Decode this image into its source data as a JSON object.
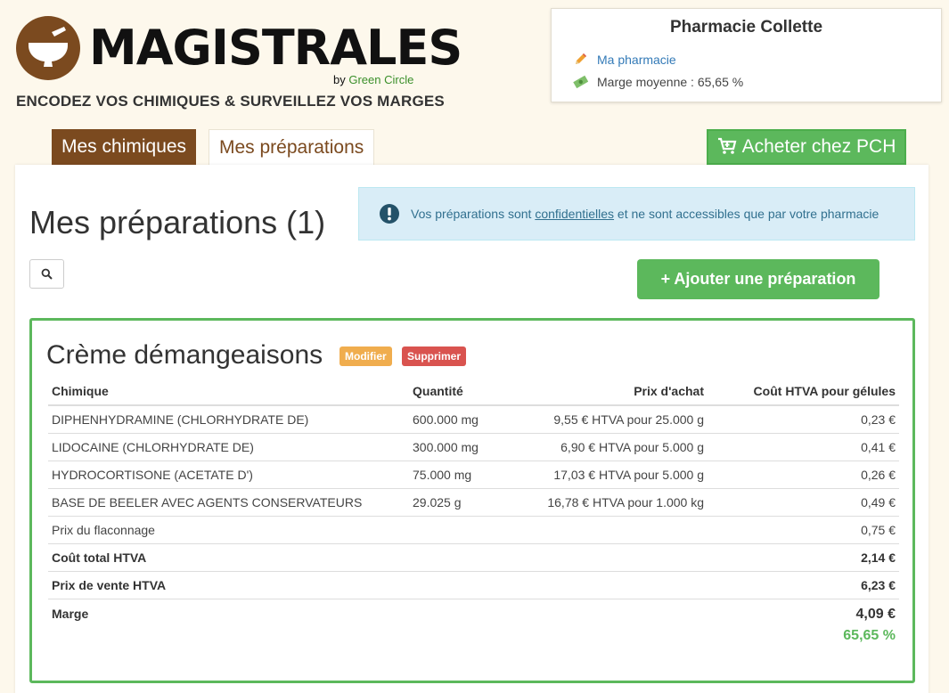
{
  "brand": {
    "name": "MAGISTRALES",
    "by": "by",
    "by_company": "Green Circle",
    "tagline": "ENCODEZ VOS CHIMIQUES & SURVEILLEZ VOS MARGES",
    "color": "#7b4a1f"
  },
  "pharmacy": {
    "name": "Pharmacie Collette",
    "link_label": "Ma pharmacie",
    "avg_margin": "Marge moyenne : 65,65 %"
  },
  "tabs": [
    {
      "label": "Mes chimiques",
      "active": true
    },
    {
      "label": "Mes préparations",
      "active": false
    }
  ],
  "buy_button": "Acheter chez PCH",
  "main": {
    "title": "Mes préparations (1)",
    "info": {
      "before": "Vos préparations sont ",
      "link": "confidentielles",
      "after": " et ne sont accessibles que par votre pharmacie"
    },
    "add_button": "+ Ajouter une préparation"
  },
  "preparation": {
    "title": "Crème démangeaisons",
    "edit_label": "Modifier",
    "delete_label": "Supprimer",
    "columns": [
      "Chimique",
      "Quantité",
      "Prix d'achat",
      "Coût HTVA pour gélules"
    ],
    "rows": [
      {
        "chem": "DIPHENHYDRAMINE (CHLORHYDRATE DE)",
        "qty": "600.000 mg",
        "price": "9,55 € HTVA pour 25.000 g",
        "cost": "0,23 €"
      },
      {
        "chem": "LIDOCAINE (CHLORHYDRATE DE)",
        "qty": "300.000 mg",
        "price": "6,90 € HTVA pour 5.000 g",
        "cost": "0,41 €"
      },
      {
        "chem": "HYDROCORTISONE (ACETATE D')",
        "qty": "75.000 mg",
        "price": "17,03 € HTVA pour 5.000 g",
        "cost": "0,26 €"
      },
      {
        "chem": "BASE DE BEELER AVEC AGENTS CONSERVATEURS",
        "qty": "29.025 g",
        "price": "16,78 € HTVA pour 1.000 kg",
        "cost": "0,49 €"
      }
    ],
    "flaconnage": {
      "label": "Prix du flaconnage",
      "value": "0,75 €"
    },
    "total": {
      "label": "Coût total HTVA",
      "value": "2,14 €"
    },
    "sale": {
      "label": "Prix de vente HTVA",
      "value": "6,23 €"
    },
    "margin": {
      "label": "Marge",
      "amount": "4,09 €",
      "percent": "65,65 %"
    }
  },
  "colors": {
    "green": "#5cb85c",
    "brown": "#7b4a1f",
    "info_bg": "#d9edf7"
  }
}
